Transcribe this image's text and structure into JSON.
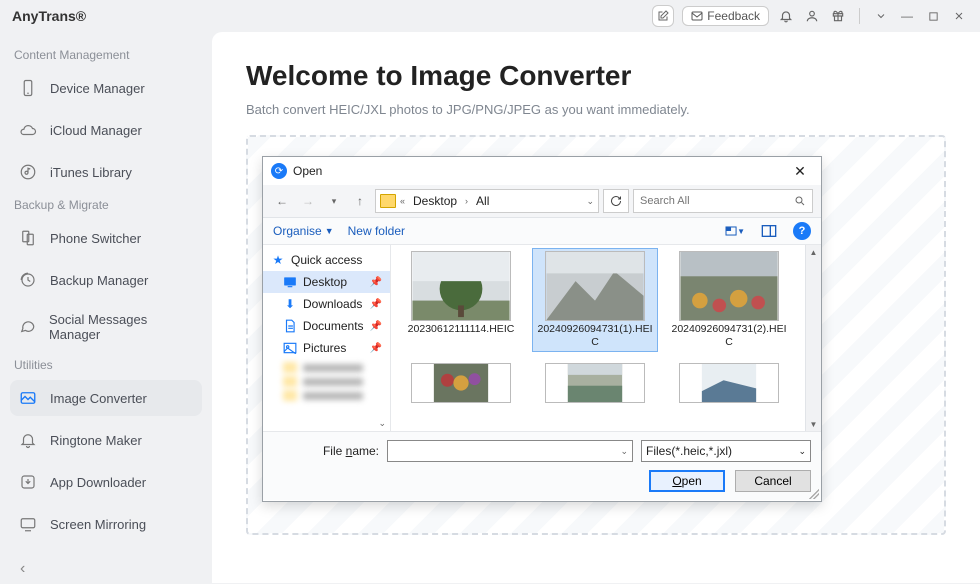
{
  "app": {
    "name": "AnyTrans®"
  },
  "titlebar": {
    "feedback": "Feedback"
  },
  "sidebar": {
    "sections": [
      {
        "label": "Content Management",
        "items": [
          {
            "label": "Device Manager",
            "icon": "phone-icon"
          },
          {
            "label": "iCloud Manager",
            "icon": "cloud-icon"
          },
          {
            "label": "iTunes Library",
            "icon": "music-note-icon"
          }
        ]
      },
      {
        "label": "Backup & Migrate",
        "items": [
          {
            "label": "Phone Switcher",
            "icon": "phone-switch-icon"
          },
          {
            "label": "Backup Manager",
            "icon": "clock-icon"
          },
          {
            "label": "Social Messages Manager",
            "icon": "chat-icon"
          }
        ]
      },
      {
        "label": "Utilities",
        "items": [
          {
            "label": "Image Converter",
            "icon": "image-icon",
            "active": true
          },
          {
            "label": "Ringtone Maker",
            "icon": "bell-icon"
          },
          {
            "label": "App Downloader",
            "icon": "download-icon"
          },
          {
            "label": "Screen Mirroring",
            "icon": "mirror-icon"
          }
        ]
      }
    ]
  },
  "page": {
    "title": "Welcome to Image Converter",
    "subtitle": "Batch convert HEIC/JXL photos to JPG/PNG/JPEG as you want immediately."
  },
  "dialog": {
    "title": "Open",
    "path": {
      "seg1": "Desktop",
      "seg2": "All"
    },
    "search_placeholder": "Search All",
    "toolbar": {
      "organise": "Organise",
      "newfolder": "New folder"
    },
    "nav": {
      "quick": "Quick access",
      "desktop": "Desktop",
      "downloads": "Downloads",
      "documents": "Documents",
      "pictures": "Pictures"
    },
    "files": [
      {
        "name": "20230612111114.HEIC",
        "thumb": "tree"
      },
      {
        "name": "20240926094731(1).HEIC",
        "thumb": "rock",
        "selected": true
      },
      {
        "name": "20240926094731(2).HEIC",
        "thumb": "garden"
      }
    ],
    "filename_label_pre": "File ",
    "filename_label_u": "n",
    "filename_label_post": "ame:",
    "filename_value": "",
    "filter": "Files(*.heic,*.jxl)",
    "open_u": "O",
    "open_rest": "pen",
    "cancel": "Cancel"
  }
}
